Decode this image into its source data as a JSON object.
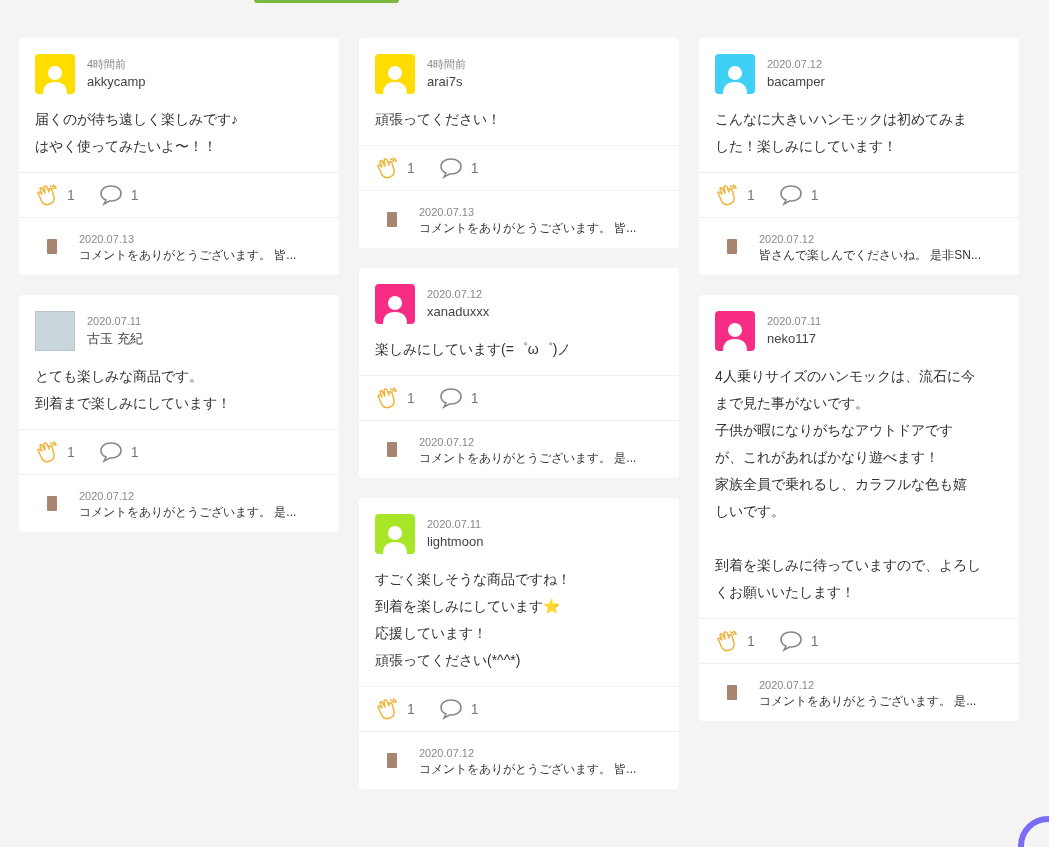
{
  "columns": [
    {
      "cards": [
        {
          "avatar": {
            "kind": "default",
            "color": "#ffdd00"
          },
          "time": "4時間前",
          "user": "akkycamp",
          "body": [
            [
              "届くのが待ち遠しく楽しみです♪",
              "はやく使ってみたいよ〜！！"
            ]
          ],
          "claps": "1",
          "comments": "1",
          "reply": {
            "date": "2020.07.13",
            "text": "コメントをありがとうございます。 皆..."
          }
        },
        {
          "avatar": {
            "kind": "photo"
          },
          "time": "2020.07.11",
          "user": "古玉 充紀",
          "body": [
            [
              "とても楽しみな商品です。",
              "到着まで楽しみにしています！"
            ]
          ],
          "claps": "1",
          "comments": "1",
          "reply": {
            "date": "2020.07.12",
            "text": "コメントをありがとうございます。 是..."
          }
        }
      ]
    },
    {
      "cards": [
        {
          "avatar": {
            "kind": "default",
            "color": "#ffdd00"
          },
          "time": "4時間前",
          "user": "arai7s",
          "body": [
            [
              "頑張ってください！"
            ]
          ],
          "claps": "1",
          "comments": "1",
          "reply": {
            "date": "2020.07.13",
            "text": "コメントをありがとうございます。 皆..."
          }
        },
        {
          "avatar": {
            "kind": "default",
            "color": "#f72c84"
          },
          "time": "2020.07.12",
          "user": "xanaduxxx",
          "body": [
            [
              "楽しみにしています(=゜ω゜)ノ"
            ]
          ],
          "claps": "1",
          "comments": "1",
          "reply": {
            "date": "2020.07.12",
            "text": "コメントをありがとうございます。 是..."
          }
        },
        {
          "avatar": {
            "kind": "default",
            "color": "#a8e628"
          },
          "time": "2020.07.11",
          "user": "lightmoon",
          "body": [
            [
              "すごく楽しそうな商品ですね！",
              "到着を楽しみにしています⭐",
              "応援しています！",
              "頑張ってください(*^^*)"
            ]
          ],
          "claps": "1",
          "comments": "1",
          "reply": {
            "date": "2020.07.12",
            "text": "コメントをありがとうございます。 皆..."
          }
        }
      ]
    },
    {
      "cards": [
        {
          "avatar": {
            "kind": "default",
            "color": "#3fd0f5"
          },
          "time": "2020.07.12",
          "user": "bacamper",
          "body": [
            [
              "こんなに大きいハンモックは初めてみま",
              "した！楽しみにしています！"
            ]
          ],
          "claps": "1",
          "comments": "1",
          "reply": {
            "date": "2020.07.12",
            "text": "皆さんで楽しんでくださいね。 是非SN..."
          }
        },
        {
          "avatar": {
            "kind": "default",
            "color": "#f72c84"
          },
          "time": "2020.07.11",
          "user": "neko117",
          "body": [
            [
              "4人乗りサイズのハンモックは、流石に今",
              "まで見た事がないです。",
              "子供が暇になりがちなアウトドアです",
              "が、これがあればかなり遊べます！",
              "家族全員で乗れるし、カラフルな色も嬉",
              "しいです。"
            ],
            [
              "到着を楽しみに待っていますので、よろし",
              "くお願いいたします！"
            ]
          ],
          "claps": "1",
          "comments": "1",
          "reply": {
            "date": "2020.07.12",
            "text": "コメントをありがとうございます。 是..."
          }
        }
      ]
    }
  ]
}
